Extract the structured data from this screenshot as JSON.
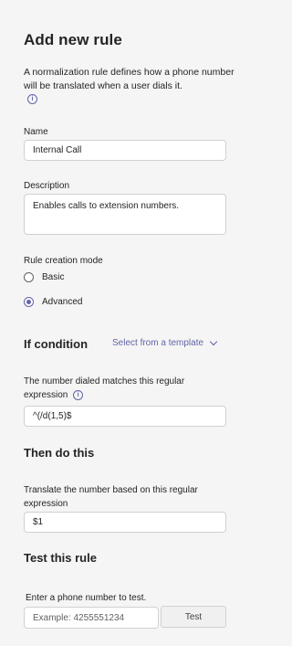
{
  "title": "Add new rule",
  "description": "A normalization rule defines how a phone number will be translated when a user dials it.",
  "name": {
    "label": "Name",
    "value": "Internal Call"
  },
  "desc_field": {
    "label": "Description",
    "value": "Enables calls to extension numbers."
  },
  "mode": {
    "label": "Rule creation mode",
    "options": [
      {
        "label": "Basic",
        "checked": false
      },
      {
        "label": "Advanced",
        "checked": true
      }
    ]
  },
  "if_condition": {
    "heading": "If condition",
    "template_link": "Select from a template",
    "regex_label": "The number dialed matches this regular expression",
    "regex_value": "^(/d(1,5)$"
  },
  "then": {
    "heading": "Then do this",
    "translate_label": "Translate the number based on this regular expression",
    "translate_value": "$1"
  },
  "test": {
    "heading": "Test this rule",
    "prompt": "Enter a phone number to test.",
    "placeholder": "Example: 4255551234",
    "button": "Test"
  },
  "colors": {
    "accent": "#6264a7",
    "background": "#f5f5f5"
  }
}
